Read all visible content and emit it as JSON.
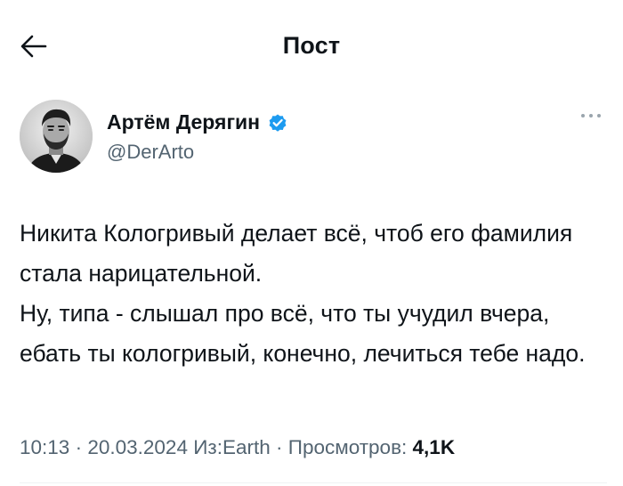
{
  "header": {
    "title": "Пост",
    "back_icon": "arrow-left-icon"
  },
  "author": {
    "name": "Артём Дерягин",
    "handle": "@DerArto",
    "verified": true,
    "verified_color": "#1d9bf0",
    "more_icon": "ellipsis-icon"
  },
  "tweet": {
    "paragraphs": [
      "Никита Кологривый делает всё, чтоб его фамилия стала нарицательной.",
      "Ну, типа - слышал про всё, что ты учудил вчера, ебать ты кологривый, конечно, лечиться тебе надо."
    ]
  },
  "meta": {
    "time": "10:13",
    "separator": "·",
    "date": "20.03.2024",
    "source_prefix": "Из:",
    "source": "Earth",
    "views_label": "Просмотров:",
    "views_count": "4,1K"
  },
  "colors": {
    "text": "#0f1419",
    "secondary": "#536471",
    "accent": "#1d9bf0"
  }
}
